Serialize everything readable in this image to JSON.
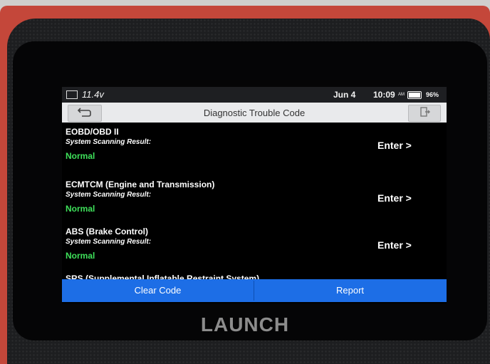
{
  "status_bar": {
    "voltage": "11.4v",
    "date": "Jun 4",
    "time": "10:09",
    "ampm": "AM",
    "battery_percent": "96%"
  },
  "header": {
    "title": "Diagnostic Trouble Code"
  },
  "systems": [
    {
      "name": "EOBD/OBD II",
      "label": "System Scanning Result:",
      "result": "Normal",
      "action": "Enter >"
    },
    {
      "name": "ECMTCM (Engine and Transmission)",
      "label": "System Scanning Result:",
      "result": "Normal",
      "action": "Enter >"
    },
    {
      "name": "ABS (Brake Control)",
      "label": "System Scanning Result:",
      "result": "Normal",
      "action": "Enter >"
    },
    {
      "name": "SRS (Supplemental Inflatable Restraint System)"
    }
  ],
  "footer": {
    "clear_code": "Clear Code",
    "report": "Report"
  },
  "device": {
    "brand": "LAUNCH"
  },
  "colors": {
    "accent": "#1d6ee6",
    "normal_status": "#3ee05a",
    "casing": "#c4473a"
  }
}
